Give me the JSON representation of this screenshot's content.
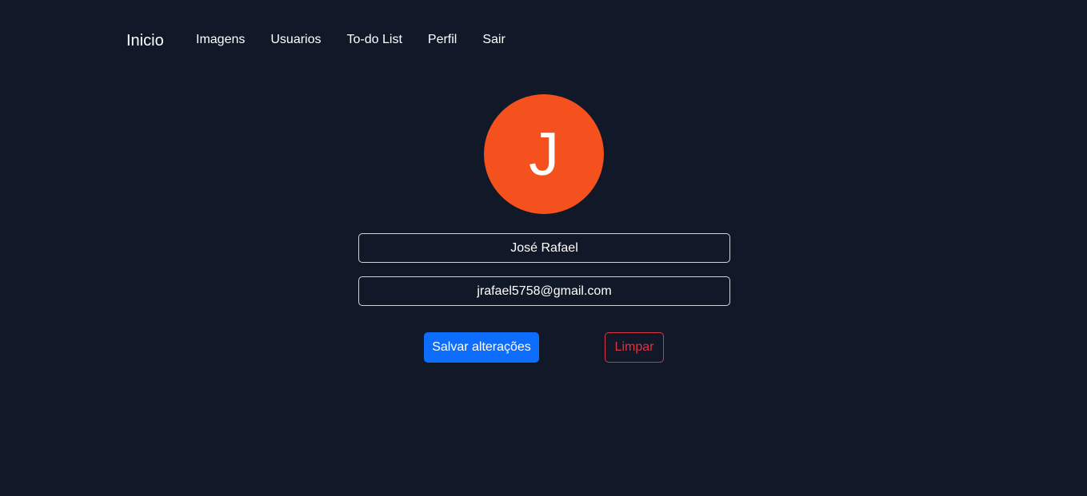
{
  "nav": {
    "brand": "Inicio",
    "links": [
      "Imagens",
      "Usuarios",
      "To-do List",
      "Perfil",
      "Sair"
    ]
  },
  "profile": {
    "avatar_letter": "J",
    "avatar_color": "#f4511e",
    "name_value": "José Rafael",
    "email_value": "jrafael5758@gmail.com"
  },
  "actions": {
    "save_label": "Salvar alterações",
    "clear_label": "Limpar"
  },
  "colors": {
    "background": "#111827",
    "primary": "#0d6efd",
    "danger": "#dc3545"
  }
}
